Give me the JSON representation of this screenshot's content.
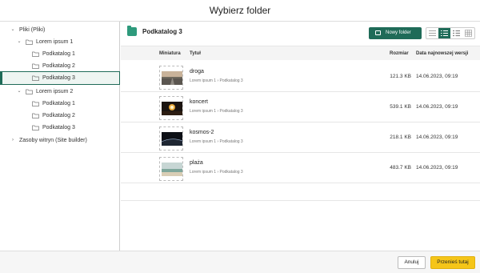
{
  "dialog": {
    "title": "Wybierz folder"
  },
  "tree": [
    {
      "label": "Pliki (Pliki)",
      "expanded": true
    },
    {
      "label": "Lorem ipsum 1",
      "expanded": true
    },
    {
      "label": "Podkatalog 1"
    },
    {
      "label": "Podkatalog 2"
    },
    {
      "label": "Podkatalog 3",
      "selected": true
    },
    {
      "label": "Lorem ipsum 2",
      "expanded": true
    },
    {
      "label": "Podkatalog 1"
    },
    {
      "label": "Podkatalog 2"
    },
    {
      "label": "Podkatalog 3"
    },
    {
      "label": "Zasoby witryn (Site builder)",
      "expanded": false
    }
  ],
  "main": {
    "current_folder": "Podkatalog 3",
    "new_folder_label": "Nowy folder",
    "view_modes": [
      "compact-list-icon",
      "detailed-list-icon",
      "list-icon",
      "grid-icon"
    ],
    "active_view": "detailed-list-icon",
    "columns": {
      "thumbnail": "Miniatura",
      "title": "Tytuł",
      "size": "Rozmiar",
      "date": "Data najnowszej wersji"
    },
    "rows": [
      {
        "name": "droga",
        "path": "Lorem ipsum 1 › Podkatalog 3",
        "size": "121.3 KB",
        "date": "14.06.2023, 09:19"
      },
      {
        "name": "koncert",
        "path": "Lorem ipsum 1 › Podkatalog 3",
        "size": "539.1 KB",
        "date": "14.06.2023, 09:19"
      },
      {
        "name": "kosmos-2",
        "path": "Lorem ipsum 1 › Podkatalog 3",
        "size": "218.1 KB",
        "date": "14.06.2023, 09:19"
      },
      {
        "name": "plaża",
        "path": "Lorem ipsum 1 › Podkatalog 3",
        "size": "483.7 KB",
        "date": "14.06.2023, 09:19"
      }
    ]
  },
  "footer": {
    "cancel_label": "Anuluj",
    "move_label": "Przenieś tutaj"
  },
  "colors": {
    "primary": "#1f6b58",
    "accent": "#f5c518",
    "folder": "#2e9a7c"
  }
}
